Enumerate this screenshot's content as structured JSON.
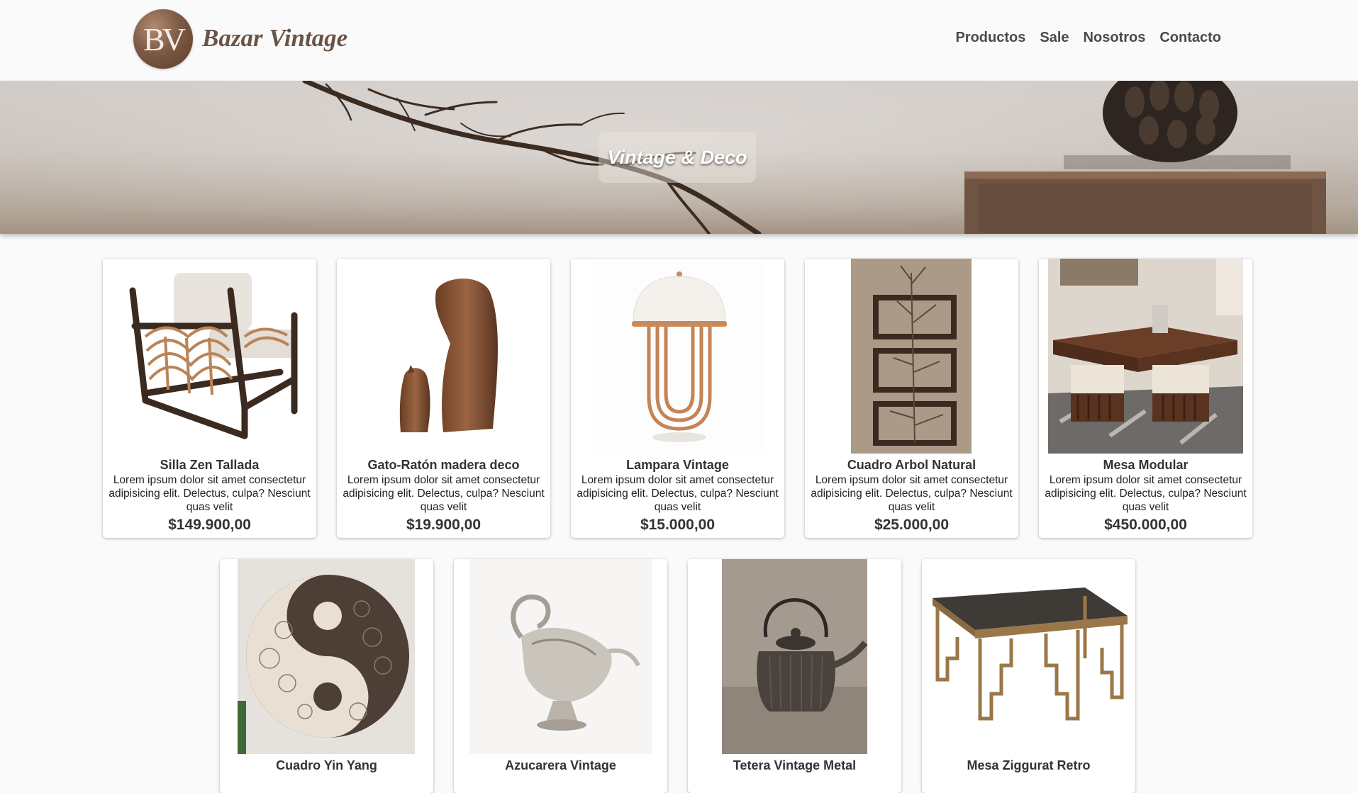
{
  "header": {
    "logo_initials": "BV",
    "logo_text": "Bazar Vintage",
    "nav": [
      "Productos",
      "Sale",
      "Nosotros",
      "Contacto"
    ]
  },
  "hero": {
    "title": "Vintage & Deco"
  },
  "products": [
    {
      "name": "Silla Zen Tallada",
      "description": "Lorem ipsum dolor sit amet consectetur adipisicing elit. Delectus, culpa? Nesciunt quas velit",
      "price": "$149.900,00",
      "icon": "armchair-image"
    },
    {
      "name": "Gato-Ratón madera deco",
      "description": "Lorem ipsum dolor sit amet consectetur adipisicing elit. Delectus, culpa? Nesciunt quas velit",
      "price": "$19.900,00",
      "icon": "wooden-cat-mouse-image"
    },
    {
      "name": "Lampara Vintage",
      "description": "Lorem ipsum dolor sit amet consectetur adipisicing elit. Delectus, culpa? Nesciunt quas velit",
      "price": "$15.000,00",
      "icon": "lamp-image"
    },
    {
      "name": "Cuadro Arbol Natural",
      "description": "Lorem ipsum dolor sit amet consectetur adipisicing elit. Delectus, culpa? Nesciunt quas velit",
      "price": "$25.000,00",
      "icon": "branch-frames-image"
    },
    {
      "name": "Mesa Modular",
      "description": "Lorem ipsum dolor sit amet consectetur adipisicing elit. Delectus, culpa? Nesciunt quas velit",
      "price": "$450.000,00",
      "icon": "modular-table-image"
    },
    {
      "name": "Cuadro Yin Yang",
      "icon": "yin-yang-image"
    },
    {
      "name": "Azucarera Vintage",
      "icon": "sugar-bowl-image"
    },
    {
      "name": "Tetera Vintage Metal",
      "icon": "kettle-image"
    },
    {
      "name": "Mesa Ziggurat Retro",
      "icon": "ziggurat-table-image"
    }
  ],
  "colors": {
    "accent": "#6b5445",
    "logo": "#7e5a44",
    "background": "#fafafa"
  }
}
